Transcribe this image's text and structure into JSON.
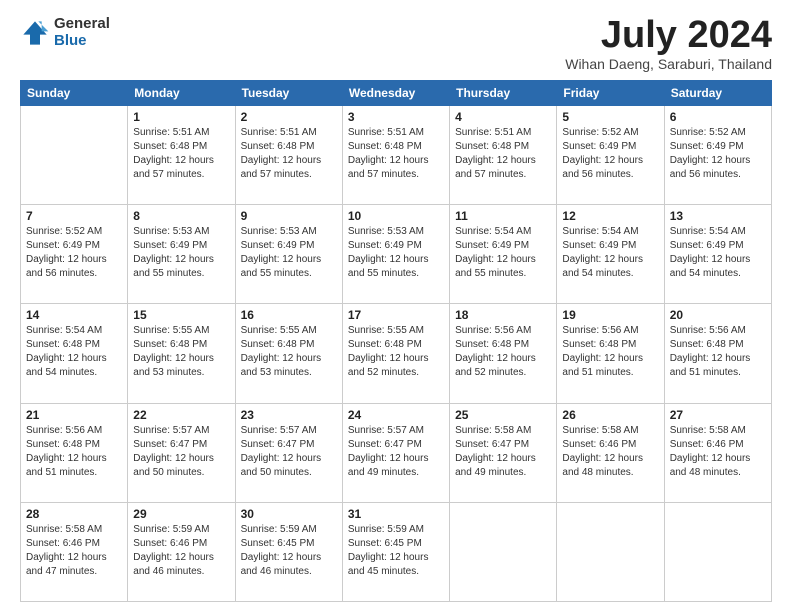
{
  "header": {
    "logo": {
      "general": "General",
      "blue": "Blue"
    },
    "title": "July 2024",
    "location": "Wihan Daeng, Saraburi, Thailand"
  },
  "days_of_week": [
    "Sunday",
    "Monday",
    "Tuesday",
    "Wednesday",
    "Thursday",
    "Friday",
    "Saturday"
  ],
  "weeks": [
    [
      {
        "day": "",
        "sunrise": "",
        "sunset": "",
        "daylight": ""
      },
      {
        "day": "1",
        "sunrise": "Sunrise: 5:51 AM",
        "sunset": "Sunset: 6:48 PM",
        "daylight": "Daylight: 12 hours and 57 minutes."
      },
      {
        "day": "2",
        "sunrise": "Sunrise: 5:51 AM",
        "sunset": "Sunset: 6:48 PM",
        "daylight": "Daylight: 12 hours and 57 minutes."
      },
      {
        "day": "3",
        "sunrise": "Sunrise: 5:51 AM",
        "sunset": "Sunset: 6:48 PM",
        "daylight": "Daylight: 12 hours and 57 minutes."
      },
      {
        "day": "4",
        "sunrise": "Sunrise: 5:51 AM",
        "sunset": "Sunset: 6:48 PM",
        "daylight": "Daylight: 12 hours and 57 minutes."
      },
      {
        "day": "5",
        "sunrise": "Sunrise: 5:52 AM",
        "sunset": "Sunset: 6:49 PM",
        "daylight": "Daylight: 12 hours and 56 minutes."
      },
      {
        "day": "6",
        "sunrise": "Sunrise: 5:52 AM",
        "sunset": "Sunset: 6:49 PM",
        "daylight": "Daylight: 12 hours and 56 minutes."
      }
    ],
    [
      {
        "day": "7",
        "sunrise": "Sunrise: 5:52 AM",
        "sunset": "Sunset: 6:49 PM",
        "daylight": "Daylight: 12 hours and 56 minutes."
      },
      {
        "day": "8",
        "sunrise": "Sunrise: 5:53 AM",
        "sunset": "Sunset: 6:49 PM",
        "daylight": "Daylight: 12 hours and 55 minutes."
      },
      {
        "day": "9",
        "sunrise": "Sunrise: 5:53 AM",
        "sunset": "Sunset: 6:49 PM",
        "daylight": "Daylight: 12 hours and 55 minutes."
      },
      {
        "day": "10",
        "sunrise": "Sunrise: 5:53 AM",
        "sunset": "Sunset: 6:49 PM",
        "daylight": "Daylight: 12 hours and 55 minutes."
      },
      {
        "day": "11",
        "sunrise": "Sunrise: 5:54 AM",
        "sunset": "Sunset: 6:49 PM",
        "daylight": "Daylight: 12 hours and 55 minutes."
      },
      {
        "day": "12",
        "sunrise": "Sunrise: 5:54 AM",
        "sunset": "Sunset: 6:49 PM",
        "daylight": "Daylight: 12 hours and 54 minutes."
      },
      {
        "day": "13",
        "sunrise": "Sunrise: 5:54 AM",
        "sunset": "Sunset: 6:49 PM",
        "daylight": "Daylight: 12 hours and 54 minutes."
      }
    ],
    [
      {
        "day": "14",
        "sunrise": "Sunrise: 5:54 AM",
        "sunset": "Sunset: 6:48 PM",
        "daylight": "Daylight: 12 hours and 54 minutes."
      },
      {
        "day": "15",
        "sunrise": "Sunrise: 5:55 AM",
        "sunset": "Sunset: 6:48 PM",
        "daylight": "Daylight: 12 hours and 53 minutes."
      },
      {
        "day": "16",
        "sunrise": "Sunrise: 5:55 AM",
        "sunset": "Sunset: 6:48 PM",
        "daylight": "Daylight: 12 hours and 53 minutes."
      },
      {
        "day": "17",
        "sunrise": "Sunrise: 5:55 AM",
        "sunset": "Sunset: 6:48 PM",
        "daylight": "Daylight: 12 hours and 52 minutes."
      },
      {
        "day": "18",
        "sunrise": "Sunrise: 5:56 AM",
        "sunset": "Sunset: 6:48 PM",
        "daylight": "Daylight: 12 hours and 52 minutes."
      },
      {
        "day": "19",
        "sunrise": "Sunrise: 5:56 AM",
        "sunset": "Sunset: 6:48 PM",
        "daylight": "Daylight: 12 hours and 51 minutes."
      },
      {
        "day": "20",
        "sunrise": "Sunrise: 5:56 AM",
        "sunset": "Sunset: 6:48 PM",
        "daylight": "Daylight: 12 hours and 51 minutes."
      }
    ],
    [
      {
        "day": "21",
        "sunrise": "Sunrise: 5:56 AM",
        "sunset": "Sunset: 6:48 PM",
        "daylight": "Daylight: 12 hours and 51 minutes."
      },
      {
        "day": "22",
        "sunrise": "Sunrise: 5:57 AM",
        "sunset": "Sunset: 6:47 PM",
        "daylight": "Daylight: 12 hours and 50 minutes."
      },
      {
        "day": "23",
        "sunrise": "Sunrise: 5:57 AM",
        "sunset": "Sunset: 6:47 PM",
        "daylight": "Daylight: 12 hours and 50 minutes."
      },
      {
        "day": "24",
        "sunrise": "Sunrise: 5:57 AM",
        "sunset": "Sunset: 6:47 PM",
        "daylight": "Daylight: 12 hours and 49 minutes."
      },
      {
        "day": "25",
        "sunrise": "Sunrise: 5:58 AM",
        "sunset": "Sunset: 6:47 PM",
        "daylight": "Daylight: 12 hours and 49 minutes."
      },
      {
        "day": "26",
        "sunrise": "Sunrise: 5:58 AM",
        "sunset": "Sunset: 6:46 PM",
        "daylight": "Daylight: 12 hours and 48 minutes."
      },
      {
        "day": "27",
        "sunrise": "Sunrise: 5:58 AM",
        "sunset": "Sunset: 6:46 PM",
        "daylight": "Daylight: 12 hours and 48 minutes."
      }
    ],
    [
      {
        "day": "28",
        "sunrise": "Sunrise: 5:58 AM",
        "sunset": "Sunset: 6:46 PM",
        "daylight": "Daylight: 12 hours and 47 minutes."
      },
      {
        "day": "29",
        "sunrise": "Sunrise: 5:59 AM",
        "sunset": "Sunset: 6:46 PM",
        "daylight": "Daylight: 12 hours and 46 minutes."
      },
      {
        "day": "30",
        "sunrise": "Sunrise: 5:59 AM",
        "sunset": "Sunset: 6:45 PM",
        "daylight": "Daylight: 12 hours and 46 minutes."
      },
      {
        "day": "31",
        "sunrise": "Sunrise: 5:59 AM",
        "sunset": "Sunset: 6:45 PM",
        "daylight": "Daylight: 12 hours and 45 minutes."
      },
      {
        "day": "",
        "sunrise": "",
        "sunset": "",
        "daylight": ""
      },
      {
        "day": "",
        "sunrise": "",
        "sunset": "",
        "daylight": ""
      },
      {
        "day": "",
        "sunrise": "",
        "sunset": "",
        "daylight": ""
      }
    ]
  ]
}
